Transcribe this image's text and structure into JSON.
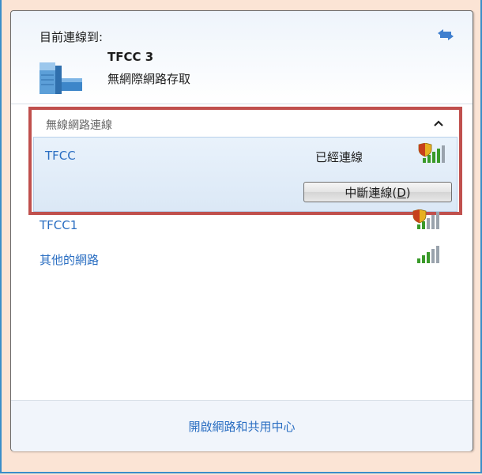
{
  "current": {
    "label": "目前連線到:",
    "network_name": "TFCC  3",
    "network_status": "無網際網路存取"
  },
  "wireless": {
    "section_title": "無線網路連線",
    "connected": {
      "ssid": "TFCC",
      "state": "已經連線",
      "disconnect_label": "中斷連線(",
      "disconnect_key": "D",
      "disconnect_suffix": ")"
    },
    "others": [
      {
        "ssid": "TFCC1",
        "secured": true
      },
      {
        "ssid": "其他的網路",
        "secured": false
      }
    ]
  },
  "footer": {
    "link": "開啟網路和共用中心"
  },
  "colors": {
    "accent": "#2a6ec2",
    "highlight_border": "#c0504d",
    "frame": "#3a8ec9",
    "background": "#fbe4d5"
  },
  "icons": [
    "refresh-icon",
    "network-icon",
    "collapse-icon",
    "wifi-signal-icon",
    "shield-icon"
  ]
}
